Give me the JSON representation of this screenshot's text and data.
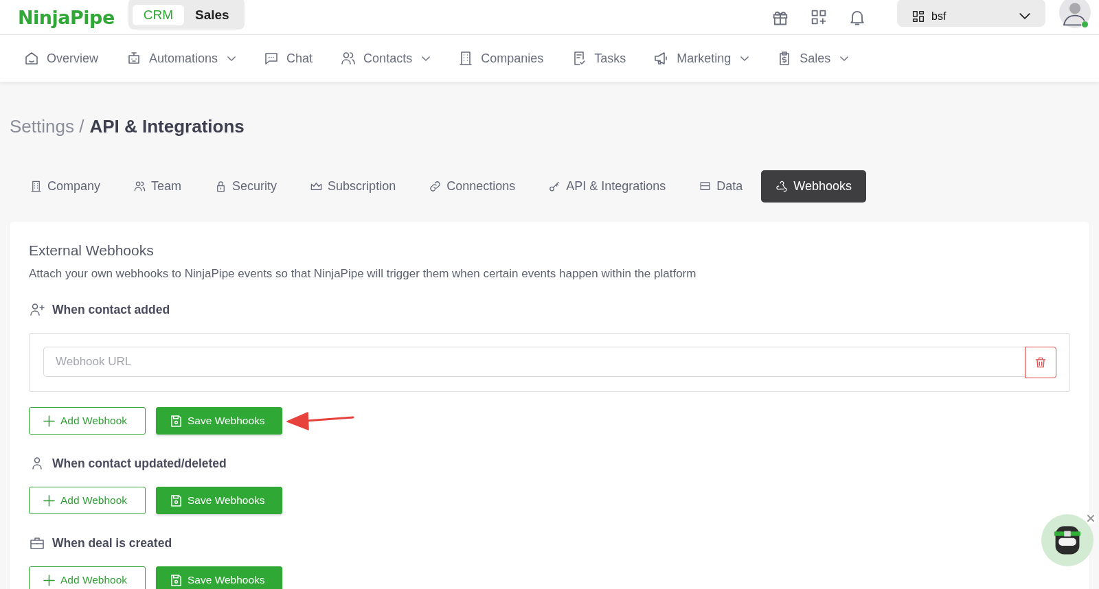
{
  "header": {
    "logo": "NinjaPipe",
    "modes": [
      {
        "label": "CRM",
        "selected": true
      },
      {
        "label": "Sales",
        "selected": false
      }
    ],
    "workspace": "bsf",
    "user_online": true
  },
  "nav": [
    {
      "label": "Overview",
      "dropdown": false
    },
    {
      "label": "Automations",
      "dropdown": true
    },
    {
      "label": "Chat",
      "dropdown": false
    },
    {
      "label": "Contacts",
      "dropdown": true
    },
    {
      "label": "Companies",
      "dropdown": false
    },
    {
      "label": "Tasks",
      "dropdown": false
    },
    {
      "label": "Marketing",
      "dropdown": true
    },
    {
      "label": "Sales",
      "dropdown": true
    }
  ],
  "breadcrumb": {
    "parent": "Settings /",
    "current": "API & Integrations"
  },
  "tabs": [
    {
      "label": "Company",
      "selected": false
    },
    {
      "label": "Team",
      "selected": false
    },
    {
      "label": "Security",
      "selected": false
    },
    {
      "label": "Subscription",
      "selected": false
    },
    {
      "label": "Connections",
      "selected": false
    },
    {
      "label": "API & Integrations",
      "selected": false
    },
    {
      "label": "Data",
      "selected": false
    },
    {
      "label": "Webhooks",
      "selected": true
    }
  ],
  "card": {
    "title": "External Webhooks",
    "description": "Attach your own webhooks to NinjaPipe events so that NinjaPipe will trigger them when certain events happen within the platform",
    "sections": [
      {
        "title": "When contact added",
        "urls": [
          {
            "placeholder": "Webhook URL"
          }
        ],
        "add_button": "Add Webhook",
        "save_button": "Save Webhooks",
        "annotated": true
      },
      {
        "title": "When contact updated/deleted",
        "add_button": "Add Webhook",
        "save_button": "Save Webhooks",
        "annotated": false
      },
      {
        "title": "When deal is created",
        "add_button": "Add Webhook",
        "save_button": "Save Webhooks",
        "annotated": false
      }
    ]
  }
}
